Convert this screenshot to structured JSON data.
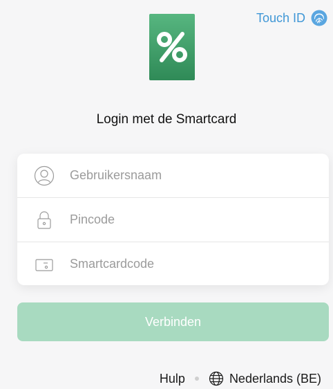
{
  "touch_id": {
    "label": "Touch ID",
    "icon": "fingerprint-icon",
    "color": "#3f97d6"
  },
  "logo": {
    "icon": "percent-icon",
    "color": "#3f9d68"
  },
  "title": "Login met de Smartcard",
  "form": {
    "username": {
      "placeholder": "Gebruikersnaam",
      "icon": "user-icon"
    },
    "pincode": {
      "placeholder": "Pincode",
      "icon": "lock-icon"
    },
    "smartcard": {
      "placeholder": "Smartcardcode",
      "icon": "card-icon"
    }
  },
  "connect_button": {
    "label": "Verbinden",
    "color": "#a8dac0"
  },
  "footer": {
    "help": "Hulp",
    "language": "Nederlands (BE)",
    "language_icon": "globe-icon"
  }
}
